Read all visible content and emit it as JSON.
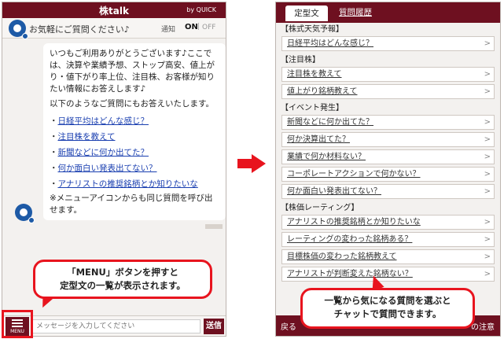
{
  "left": {
    "header": {
      "title": "株talk",
      "by": "by QUICK"
    },
    "subheader": {
      "greeting": "お気軽にご質問ください♪",
      "notice_label": "通知",
      "on": "ON",
      "sep": "|",
      "off": "OFF"
    },
    "bubble": {
      "intro": "いつもご利用ありがとうございます♪ここでは、決算や業績予想、ストップ高安、値上がり・値下がり率上位、注目株、お客様が知りたい情報にお答えします♪",
      "lead": "以下のようなご質問にもお答えいたします。",
      "links": [
        "日経平均はどんな感じ？",
        "注目株を教えて",
        "新聞などに何か出てた？",
        "何か面白い発表出てない？",
        "アナリストの推奨銘柄とか知りたいな"
      ],
      "bullet": "・",
      "note": "※メニューアイコンからも同じ質問を呼び出せます。"
    },
    "input": {
      "menu_label": "MENU",
      "placeholder": "メッセージを入力してください",
      "send": "送信"
    },
    "callout": {
      "line1": "「MENU」ボタンを押すと",
      "line2": "定型文の一覧が表示されます。"
    }
  },
  "right": {
    "tabs": {
      "fixed": "定型文",
      "history": "質問履歴"
    },
    "groups": [
      {
        "title": "【株式天気予報】",
        "items": [
          "日経平均はどんな感じ？"
        ]
      },
      {
        "title": "【注目株】",
        "items": [
          "注目株を教えて",
          "値上がり銘柄教えて"
        ]
      },
      {
        "title": "【イベント発生】",
        "items": [
          "新聞などに何か出てた？",
          "何か決算出てた？",
          "業績で何か材料ない？",
          "コーポレートアクションで何かない？",
          "何か面白い発表出てない？"
        ]
      },
      {
        "title": "【株価レーティング】",
        "items": [
          "アナリストの推奨銘柄とか知りたいな",
          "レーティングの変わった銘柄ある？",
          "目標株価の変わった銘柄教えて",
          "アナリストが判断変えた銘柄ない？"
        ]
      }
    ],
    "chevron": ">",
    "footer": {
      "back": "戻る",
      "caution": "の注意"
    },
    "callout": {
      "line1": "一覧から気になる質問を選ぶと",
      "line2": "チャットで質問できます。"
    }
  },
  "colors": {
    "brand": "#6e1020",
    "accent_red": "#e8141e",
    "link": "#1a3fb0",
    "logo_blue": "#1d5aa6"
  }
}
